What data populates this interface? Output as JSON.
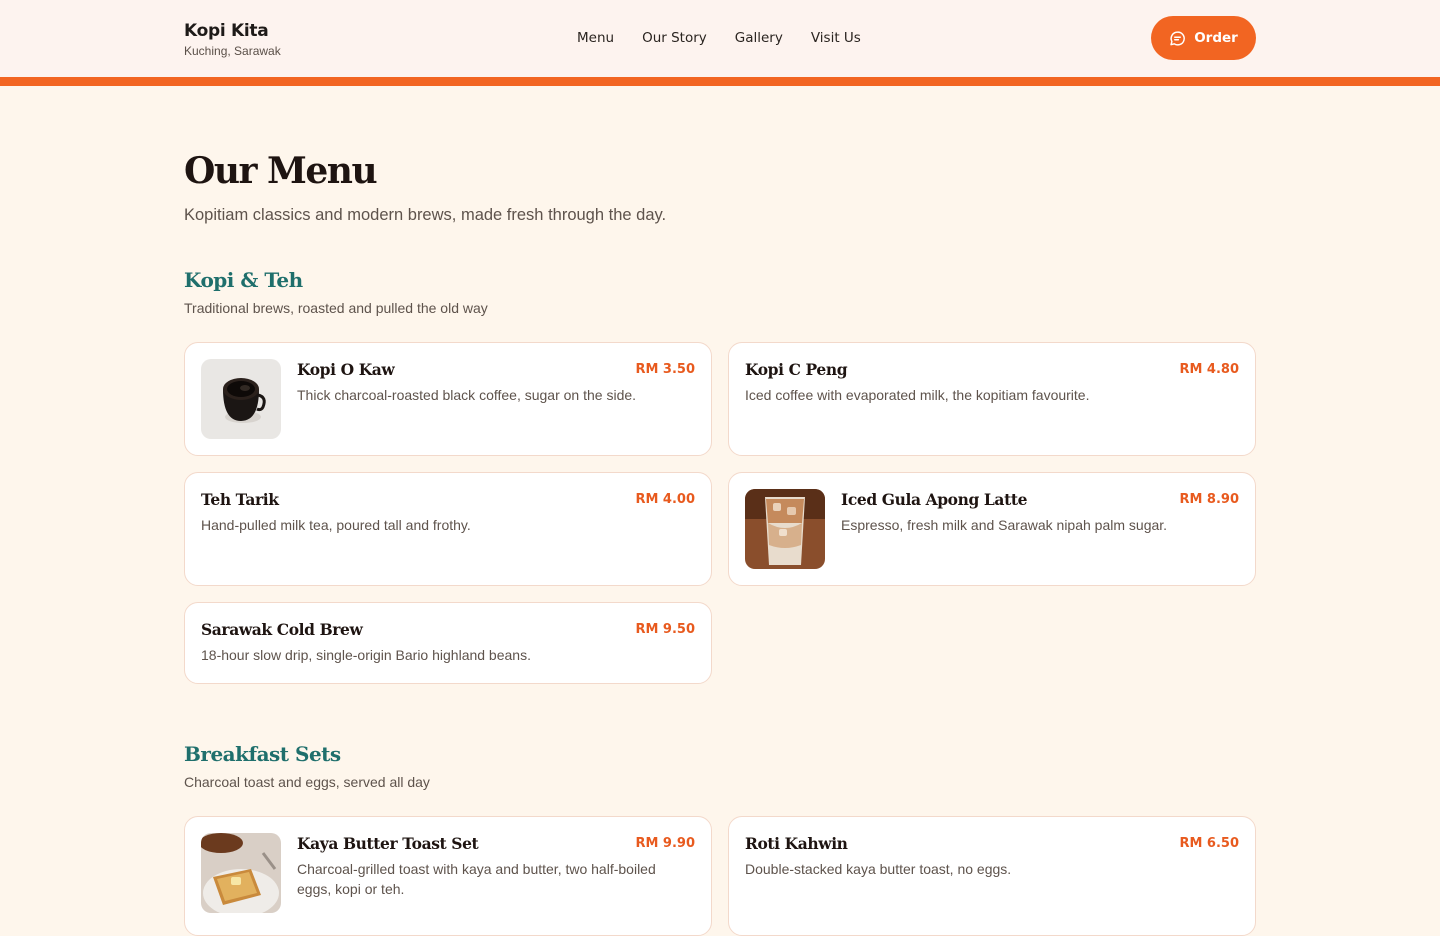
{
  "header": {
    "brand_name": "Kopi Kita",
    "brand_location": "Kuching, Sarawak",
    "nav": [
      "Menu",
      "Our Story",
      "Gallery",
      "Visit Us"
    ],
    "order_label": "Order"
  },
  "main": {
    "title": "Our Menu",
    "subtitle": "Kopitiam classics and modern brews, made fresh through the day."
  },
  "sections": [
    {
      "title": "Kopi & Teh",
      "subtitle": "Traditional brews, roasted and pulled the old way",
      "items": [
        {
          "name": "Kopi O Kaw",
          "price": "RM 3.50",
          "desc": "Thick charcoal-roasted black coffee, sugar on the side."
        },
        {
          "name": "Kopi C Peng",
          "price": "RM 4.80",
          "desc": "Iced coffee with evaporated milk, the kopitiam favourite."
        },
        {
          "name": "Teh Tarik",
          "price": "RM 4.00",
          "desc": "Hand-pulled milk tea, poured tall and frothy."
        },
        {
          "name": "Iced Gula Apong Latte",
          "price": "RM 8.90",
          "desc": "Espresso, fresh milk and Sarawak nipah palm sugar."
        },
        {
          "name": "Sarawak Cold Brew",
          "price": "RM 9.50",
          "desc": "18-hour slow drip, single-origin Bario highland beans."
        }
      ]
    },
    {
      "title": "Breakfast Sets",
      "subtitle": "Charcoal toast and eggs, served all day",
      "items": [
        {
          "name": "Kaya Butter Toast Set",
          "price": "RM 9.90",
          "desc": "Charcoal-grilled toast with kaya and butter, two half-boiled eggs, kopi or teh."
        },
        {
          "name": "Roti Kahwin",
          "price": "RM 6.50",
          "desc": "Double-stacked kaya butter toast, no eggs."
        }
      ]
    }
  ],
  "colors": {
    "accent": "#f26522",
    "section_title": "#1f6f6c",
    "background": "#fef6ec",
    "price": "#e85a1e"
  },
  "icons": {
    "order": "chat-bubble-icon"
  }
}
